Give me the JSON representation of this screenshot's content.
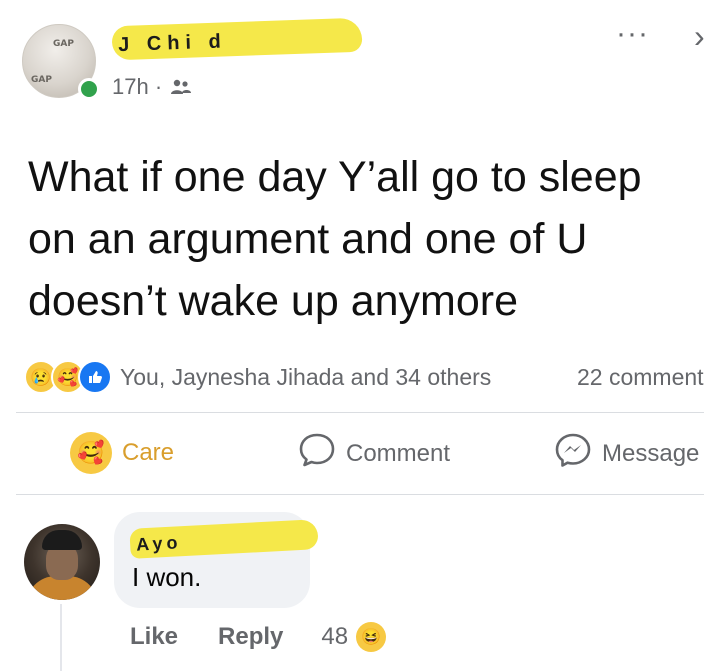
{
  "post": {
    "author_name_visible_fragment": "J      Chi   d",
    "timestamp": "17h ·",
    "audience_icon": "friends-icon",
    "more_icon": "more-horizontal-icon",
    "more_glyph": "···",
    "close_icon": "close-chevron-icon",
    "close_glyph": "›",
    "avatar_shirt_text": "GAP",
    "text": "What if one day Y’all go to sleep\non an argument and one of U\ndoesn’t wake up anymore"
  },
  "reactions": {
    "icons": [
      "sad-reaction-icon",
      "care-reaction-icon",
      "like-reaction-icon"
    ],
    "sad_glyph": "😢",
    "care_glyph": "🥰",
    "like_glyph": "👍",
    "reactors": "You, Jaynesha Jihada and 34 others",
    "comment_count": "22 comment"
  },
  "actions": {
    "care_label": "Care",
    "care_glyph": "🥰",
    "comment_label": "Comment",
    "message_label": "Message"
  },
  "comment": {
    "author_name_visible_fragment": "Ayo",
    "text": "I won.",
    "like_label": "Like",
    "reply_label": "Reply",
    "reaction_count": "48",
    "reaction_icon": "haha-reaction-icon",
    "reaction_glyph": "😆"
  },
  "colors": {
    "secondary_text": "#65676b",
    "care_label": "#d99e2c",
    "online": "#31a24c",
    "like_blue": "#1877f2",
    "redaction_yellow": "#f5e84a",
    "bubble_bg": "#f0f2f5"
  }
}
